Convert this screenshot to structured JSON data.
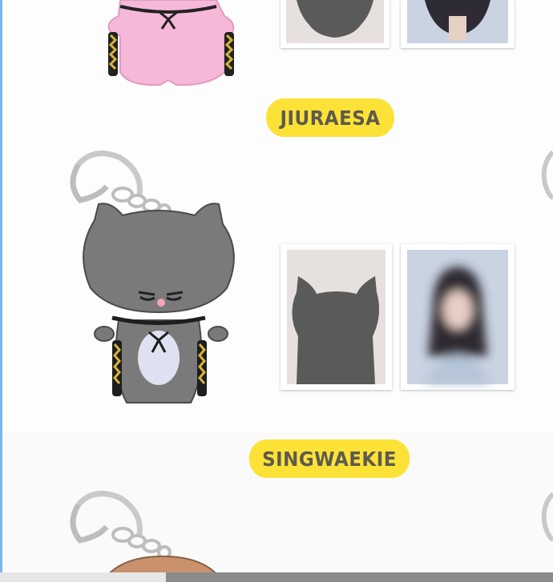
{
  "names": {
    "first": "JIURAESA",
    "second": "SINGWAEKIE"
  },
  "colors": {
    "pill": "#fce236",
    "pill_text": "#5e5a4e",
    "gray_cat": "#7a7a7a",
    "pink_cat": "#f6b8d8",
    "left_edge": "#7cb5ee"
  }
}
